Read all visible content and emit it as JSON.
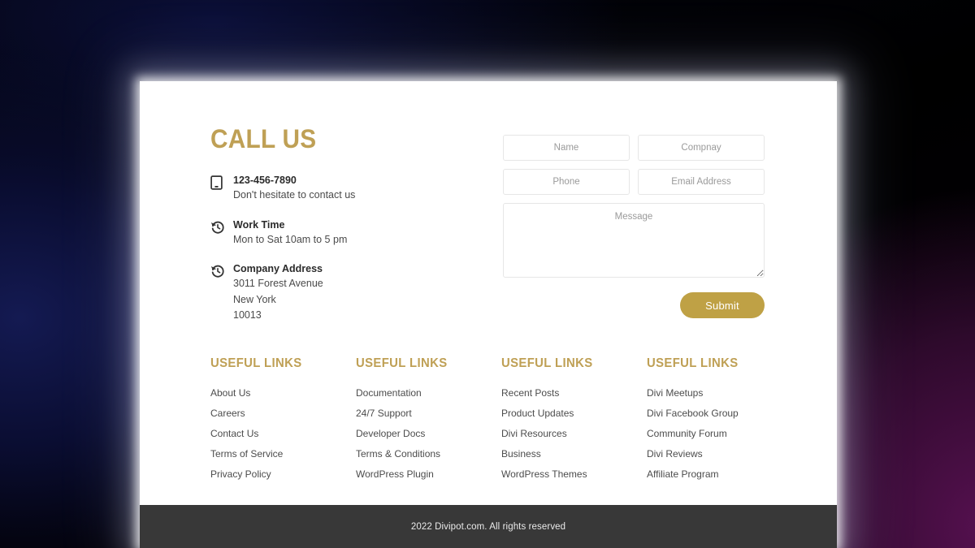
{
  "theme": {
    "gold": "#bfa055",
    "button_gold": "#bfa145",
    "card_bg": "#ffffff",
    "footer_bar_bg": "#383838",
    "body_text": "#4a4a4a",
    "heading_text": "#2b2b2b",
    "field_border": "#e6e6e6",
    "placeholder": "#9a9a9a"
  },
  "contact": {
    "title": "CALL US",
    "rows": [
      {
        "icon": "mobile-phone-icon",
        "title": "123-456-7890",
        "lines": [
          "Don't hesitate to contact us"
        ]
      },
      {
        "icon": "history-clock-icon",
        "title": "Work Time",
        "lines": [
          "Mon to Sat 10am to 5 pm"
        ]
      },
      {
        "icon": "history-clock-icon",
        "title": "Company Address",
        "lines": [
          "3011 Forest Avenue",
          "New York",
          "10013"
        ]
      }
    ]
  },
  "form": {
    "fields": {
      "name": {
        "placeholder": "Name",
        "value": ""
      },
      "company": {
        "placeholder": "Compnay",
        "value": ""
      },
      "phone": {
        "placeholder": "Phone",
        "value": ""
      },
      "email": {
        "placeholder": "Email Address",
        "value": ""
      },
      "message": {
        "placeholder": "Message",
        "value": ""
      }
    },
    "submit_label": "Submit"
  },
  "link_columns": [
    {
      "title": "USEFUL LINKS",
      "items": [
        "About Us",
        "Careers",
        "Contact Us",
        "Terms of Service",
        "Privacy Policy"
      ]
    },
    {
      "title": "USEFUL LINKS",
      "items": [
        "Documentation",
        "24/7 Support",
        "Developer Docs",
        "Terms & Conditions",
        "WordPress Plugin"
      ]
    },
    {
      "title": "USEFUL LINKS",
      "items": [
        "Recent Posts",
        "Product Updates",
        "Divi Resources",
        "Business",
        "WordPress Themes"
      ]
    },
    {
      "title": "USEFUL LINKS",
      "items": [
        "Divi Meetups",
        "Divi Facebook Group",
        "Community Forum",
        "Divi Reviews",
        "Affiliate Program"
      ]
    }
  ],
  "footer": {
    "copyright": "2022 Divipot.com. All rights reserved"
  }
}
